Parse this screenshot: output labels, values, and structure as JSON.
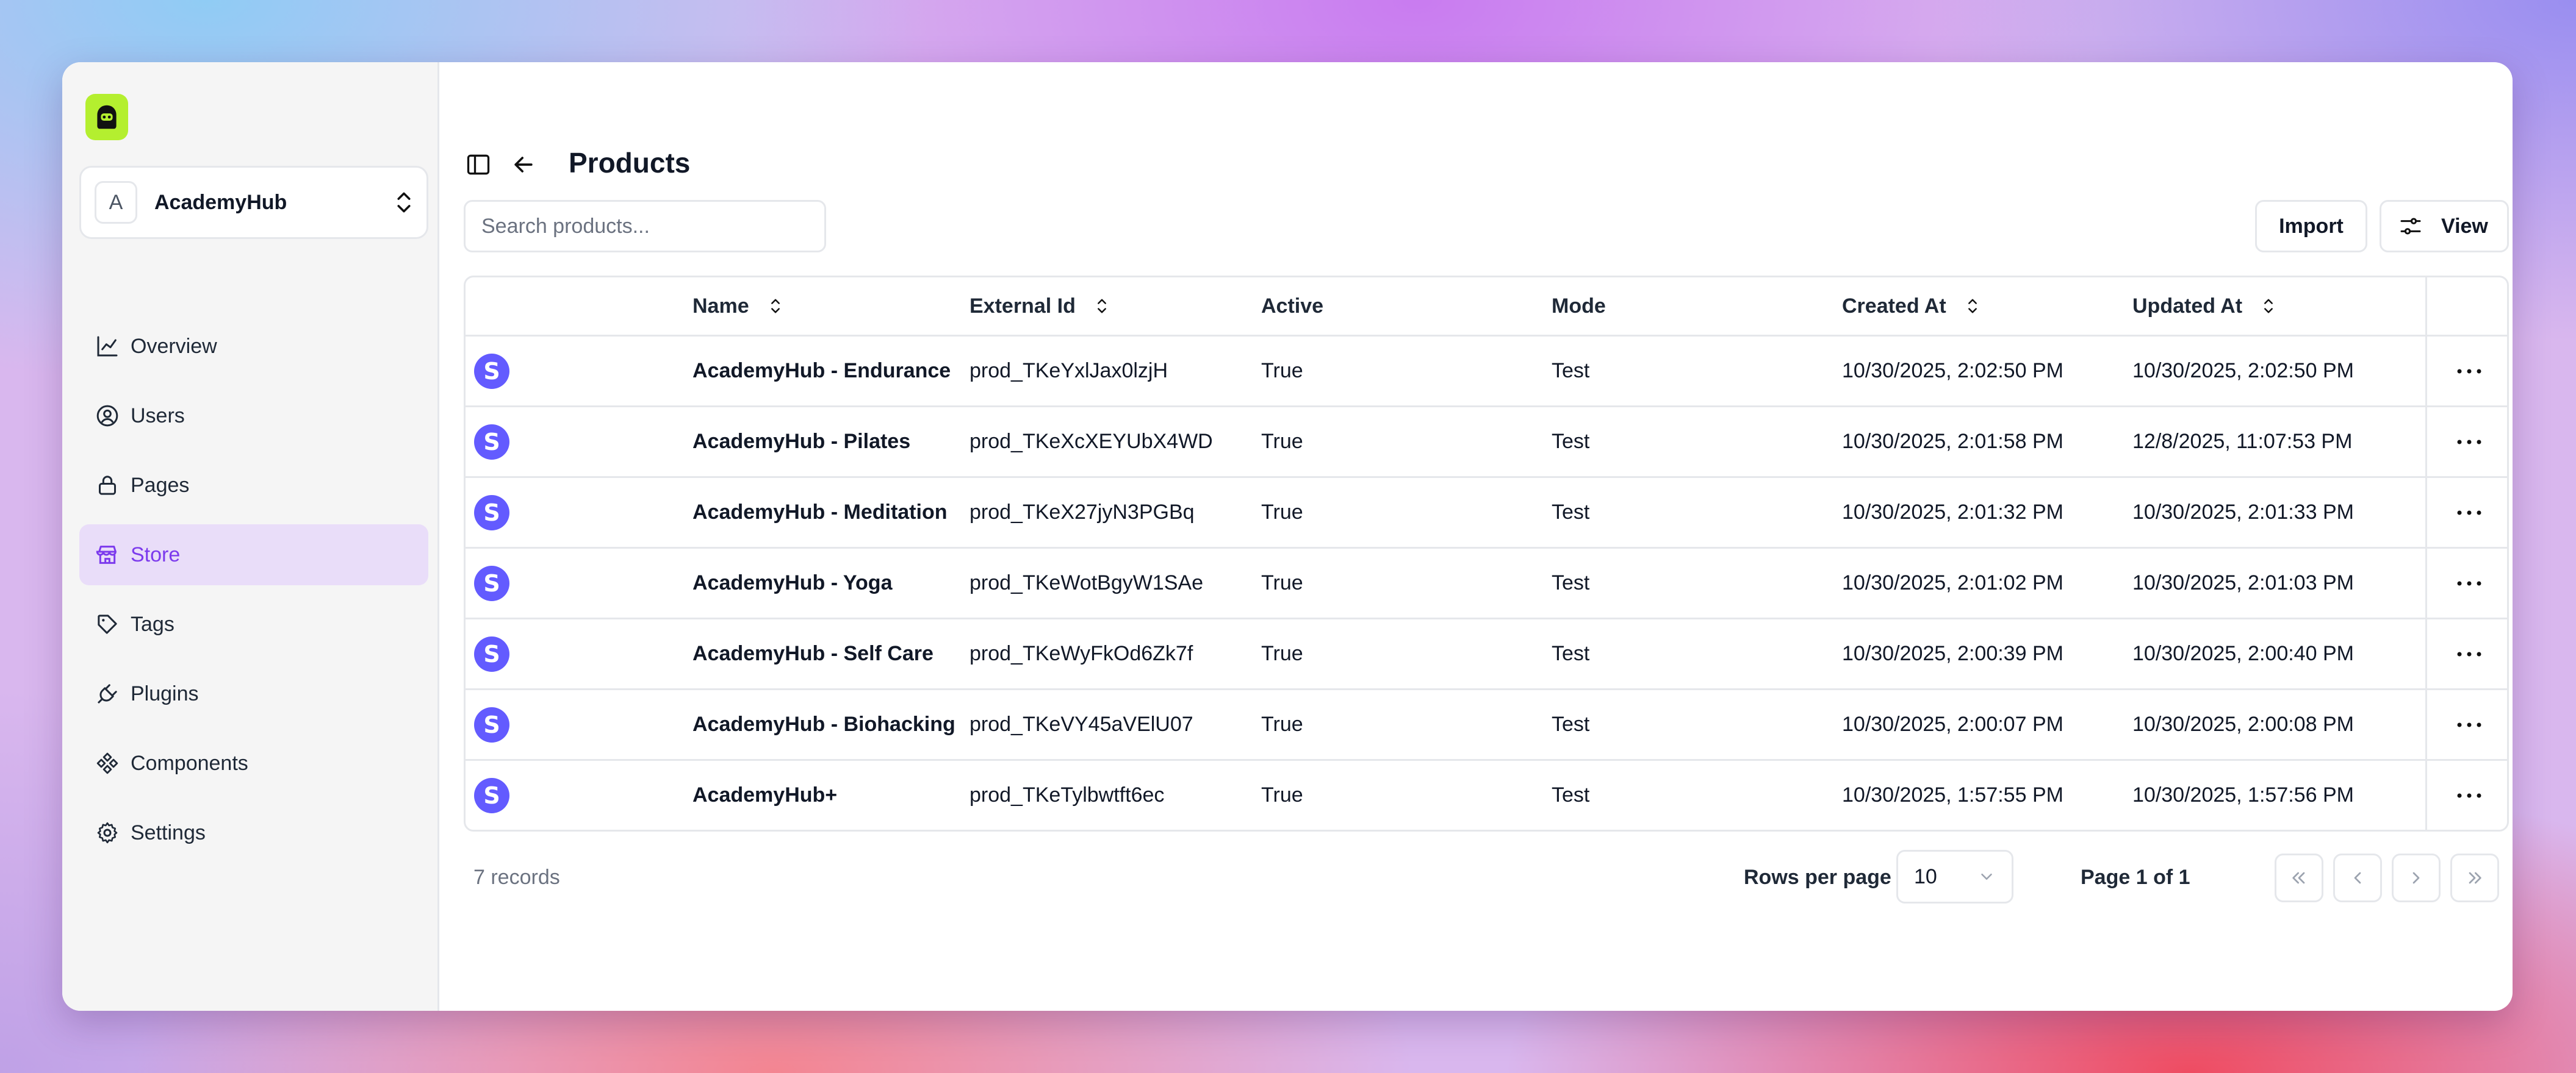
{
  "app": {
    "org_initial": "A",
    "org_name": "AcademyHub",
    "accent_color": "#7c3aed",
    "logo_color": "#b4ef2f",
    "stripe_color": "#635bff"
  },
  "sidebar": {
    "items": [
      {
        "label": "Overview",
        "icon": "chart-line-icon",
        "active": false
      },
      {
        "label": "Users",
        "icon": "user-circle-icon",
        "active": false
      },
      {
        "label": "Pages",
        "icon": "lock-icon",
        "active": false
      },
      {
        "label": "Store",
        "icon": "store-icon",
        "active": true
      },
      {
        "label": "Tags",
        "icon": "tag-icon",
        "active": false
      },
      {
        "label": "Plugins",
        "icon": "plug-icon",
        "active": false
      },
      {
        "label": "Components",
        "icon": "components-icon",
        "active": false
      },
      {
        "label": "Settings",
        "icon": "gear-icon",
        "active": false
      }
    ]
  },
  "header": {
    "title": "Products"
  },
  "toolbar": {
    "search_placeholder": "Search products...",
    "import_label": "Import",
    "view_label": "View"
  },
  "table": {
    "columns": {
      "name": "Name",
      "external_id": "External Id",
      "active": "Active",
      "mode": "Mode",
      "created_at": "Created At",
      "updated_at": "Updated At"
    },
    "rows": [
      {
        "icon": "S",
        "name": "AcademyHub - Endurance",
        "external_id": "prod_TKeYxlJax0lzjH",
        "active": "True",
        "mode": "Test",
        "created_at": "10/30/2025, 2:02:50 PM",
        "updated_at": "10/30/2025, 2:02:50 PM"
      },
      {
        "icon": "S",
        "name": "AcademyHub - Pilates",
        "external_id": "prod_TKeXcXEYUbX4WD",
        "active": "True",
        "mode": "Test",
        "created_at": "10/30/2025, 2:01:58 PM",
        "updated_at": "12/8/2025, 11:07:53 PM"
      },
      {
        "icon": "S",
        "name": "AcademyHub - Meditation",
        "external_id": "prod_TKeX27jyN3PGBq",
        "active": "True",
        "mode": "Test",
        "created_at": "10/30/2025, 2:01:32 PM",
        "updated_at": "10/30/2025, 2:01:33 PM"
      },
      {
        "icon": "S",
        "name": "AcademyHub - Yoga",
        "external_id": "prod_TKeWotBgyW1SAe",
        "active": "True",
        "mode": "Test",
        "created_at": "10/30/2025, 2:01:02 PM",
        "updated_at": "10/30/2025, 2:01:03 PM"
      },
      {
        "icon": "S",
        "name": "AcademyHub - Self Care",
        "external_id": "prod_TKeWyFkOd6Zk7f",
        "active": "True",
        "mode": "Test",
        "created_at": "10/30/2025, 2:00:39 PM",
        "updated_at": "10/30/2025, 2:00:40 PM"
      },
      {
        "icon": "S",
        "name": "AcademyHub - Biohacking",
        "external_id": "prod_TKeVY45aVElU07",
        "active": "True",
        "mode": "Test",
        "created_at": "10/30/2025, 2:00:07 PM",
        "updated_at": "10/30/2025, 2:00:08 PM"
      },
      {
        "icon": "S",
        "name": "AcademyHub+",
        "external_id": "prod_TKeTylbwtft6ec",
        "active": "True",
        "mode": "Test",
        "created_at": "10/30/2025, 1:57:55 PM",
        "updated_at": "10/30/2025, 1:57:56 PM"
      }
    ]
  },
  "footer": {
    "records_text": "7 records",
    "rows_per_page_label": "Rows per page",
    "rows_per_page_value": "10",
    "page_text": "Page 1 of 1"
  }
}
